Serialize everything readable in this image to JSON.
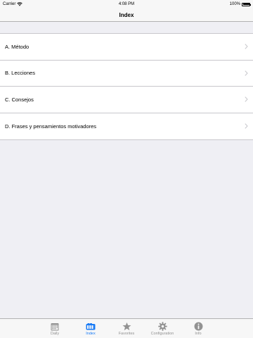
{
  "status_bar": {
    "carrier": "Carrier",
    "time": "4:08 PM",
    "battery_percent": "100%",
    "battery_level": 1.0
  },
  "nav": {
    "title": "Index"
  },
  "list": {
    "items": [
      {
        "label": "A. Método"
      },
      {
        "label": "B. Lecciones"
      },
      {
        "label": "C. Consejos"
      },
      {
        "label": "D. Frases y pensamientos motivadores"
      }
    ]
  },
  "tab_bar": {
    "active_color": "#1b7cf6",
    "inactive_color": "#929292",
    "tabs": [
      {
        "label": "Daily",
        "icon": "calendar-icon",
        "active": false
      },
      {
        "label": "Index",
        "icon": "index-icon",
        "active": true
      },
      {
        "label": "Favorites",
        "icon": "star-icon",
        "active": false
      },
      {
        "label": "Configuration",
        "icon": "gear-icon",
        "active": false
      },
      {
        "label": "Info",
        "icon": "info-icon",
        "active": false
      }
    ]
  }
}
